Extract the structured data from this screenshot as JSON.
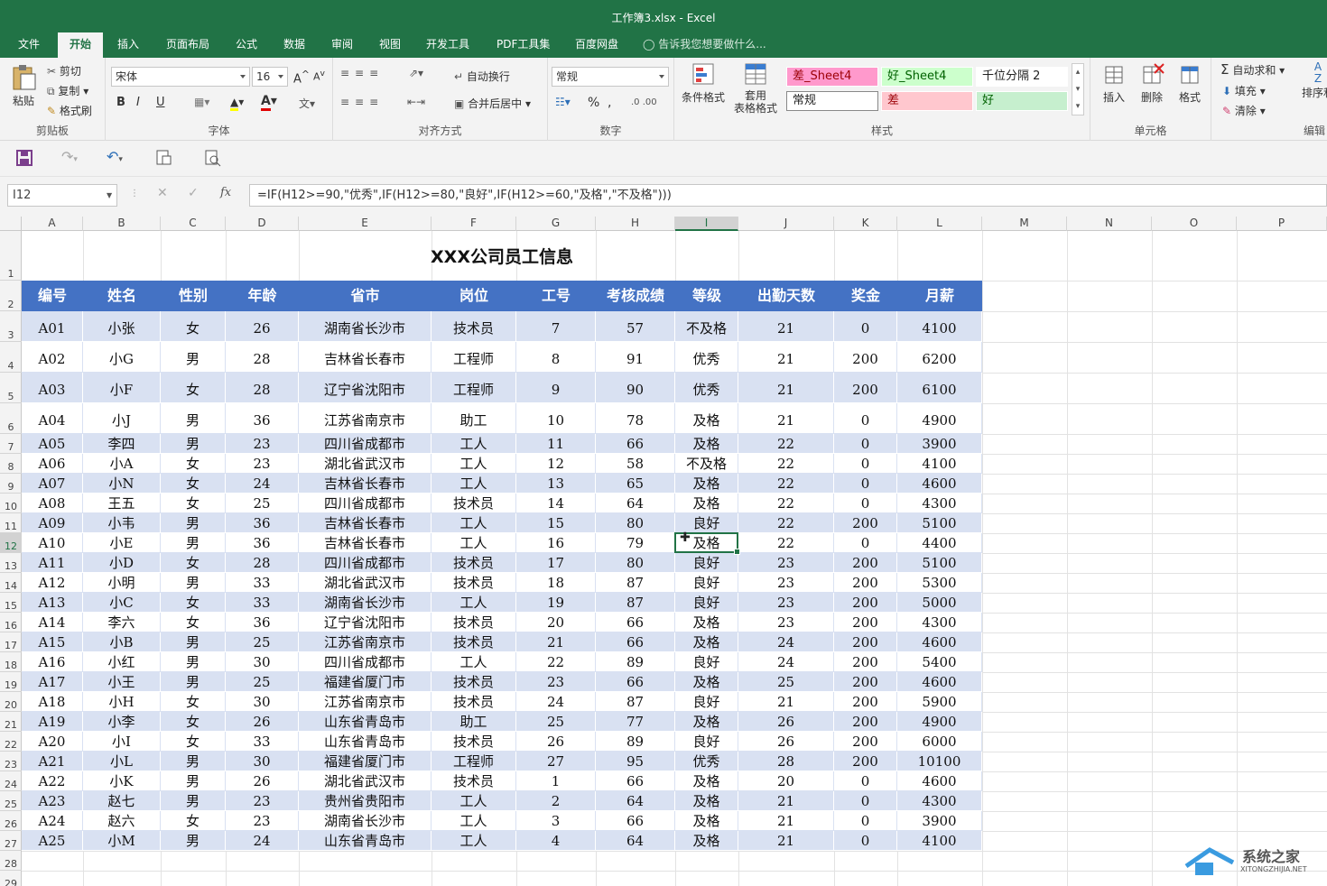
{
  "window": {
    "title": "工作簿3.xlsx - Excel"
  },
  "ribbon_tabs": [
    "文件",
    "开始",
    "插入",
    "页面布局",
    "公式",
    "数据",
    "审阅",
    "视图",
    "开发工具",
    "PDF工具集",
    "百度网盘"
  ],
  "tell_me": "告诉我您想要做什么...",
  "clipboard": {
    "paste": "粘贴",
    "cut": "剪切",
    "copy": "复制",
    "format_painter": "格式刷",
    "label": "剪贴板"
  },
  "font": {
    "name": "宋体",
    "size": "16",
    "bold": "B",
    "italic": "I",
    "underline": "U",
    "label": "字体"
  },
  "alignment": {
    "wrap": "自动换行",
    "merge": "合并后居中",
    "label": "对齐方式"
  },
  "number": {
    "format": "常规",
    "percent": "%",
    "comma": ",",
    "label": "数字"
  },
  "styles": {
    "conditional": "条件格式",
    "table_format_1": "套用",
    "table_format_2": "表格格式",
    "cells": [
      {
        "text": "差_Sheet4",
        "bg": "#ff99cc",
        "fg": "#9c0006"
      },
      {
        "text": "好_Sheet4",
        "bg": "#ccffcc",
        "fg": "#006100"
      },
      {
        "text": "千位分隔 2",
        "bg": "#ffffff",
        "fg": "#222222"
      },
      {
        "text": "常规",
        "bg": "#ffffff",
        "fg": "#222222"
      },
      {
        "text": "差",
        "bg": "#ffc7ce",
        "fg": "#9c0006"
      },
      {
        "text": "好",
        "bg": "#c6efce",
        "fg": "#006100"
      }
    ],
    "label": "样式"
  },
  "cells_group": {
    "insert": "插入",
    "delete": "删除",
    "format": "格式",
    "label": "单元格"
  },
  "editing": {
    "autosum": "自动求和",
    "fill": "填充",
    "clear": "清除",
    "sort": "排序和",
    "label": "编辑"
  },
  "formula_bar": {
    "name_box": "I12",
    "fx": "fx",
    "formula": "=IF(H12>=90,\"优秀\",IF(H12>=80,\"良好\",IF(H12>=60,\"及格\",\"不及格\")))"
  },
  "column_letters": [
    "A",
    "B",
    "C",
    "D",
    "E",
    "F",
    "G",
    "H",
    "I",
    "J",
    "K",
    "L",
    "M",
    "N",
    "O",
    "P"
  ],
  "row_numbers": [
    "1",
    "2",
    "3",
    "4",
    "5",
    "6",
    "7",
    "8",
    "9",
    "10",
    "11",
    "12",
    "13",
    "14",
    "15",
    "16",
    "17",
    "18",
    "19",
    "20",
    "21",
    "22",
    "23",
    "24",
    "25",
    "26",
    "27",
    "28",
    "29"
  ],
  "sheet": {
    "title": "XXX公司员工信息",
    "headers": [
      "编号",
      "姓名",
      "性别",
      "年龄",
      "省市",
      "岗位",
      "工号",
      "考核成绩",
      "等级",
      "出勤天数",
      "奖金",
      "月薪"
    ],
    "rows": [
      [
        "A01",
        "小张",
        "女",
        "26",
        "湖南省长沙市",
        "技术员",
        "7",
        "57",
        "不及格",
        "21",
        "0",
        "4100"
      ],
      [
        "A02",
        "小G",
        "男",
        "28",
        "吉林省长春市",
        "工程师",
        "8",
        "91",
        "优秀",
        "21",
        "200",
        "6200"
      ],
      [
        "A03",
        "小F",
        "女",
        "28",
        "辽宁省沈阳市",
        "工程师",
        "9",
        "90",
        "优秀",
        "21",
        "200",
        "6100"
      ],
      [
        "A04",
        "小J",
        "男",
        "36",
        "江苏省南京市",
        "助工",
        "10",
        "78",
        "及格",
        "21",
        "0",
        "4900"
      ],
      [
        "A05",
        "李四",
        "男",
        "23",
        "四川省成都市",
        "工人",
        "11",
        "66",
        "及格",
        "22",
        "0",
        "3900"
      ],
      [
        "A06",
        "小A",
        "女",
        "23",
        "湖北省武汉市",
        "工人",
        "12",
        "58",
        "不及格",
        "22",
        "0",
        "4100"
      ],
      [
        "A07",
        "小N",
        "女",
        "24",
        "吉林省长春市",
        "工人",
        "13",
        "65",
        "及格",
        "22",
        "0",
        "4600"
      ],
      [
        "A08",
        "王五",
        "女",
        "25",
        "四川省成都市",
        "技术员",
        "14",
        "64",
        "及格",
        "22",
        "0",
        "4300"
      ],
      [
        "A09",
        "小韦",
        "男",
        "36",
        "吉林省长春市",
        "工人",
        "15",
        "80",
        "良好",
        "22",
        "200",
        "5100"
      ],
      [
        "A10",
        "小E",
        "男",
        "36",
        "吉林省长春市",
        "工人",
        "16",
        "79",
        "及格",
        "22",
        "0",
        "4400"
      ],
      [
        "A11",
        "小D",
        "女",
        "28",
        "四川省成都市",
        "技术员",
        "17",
        "80",
        "良好",
        "23",
        "200",
        "5100"
      ],
      [
        "A12",
        "小明",
        "男",
        "33",
        "湖北省武汉市",
        "技术员",
        "18",
        "87",
        "良好",
        "23",
        "200",
        "5300"
      ],
      [
        "A13",
        "小C",
        "女",
        "33",
        "湖南省长沙市",
        "工人",
        "19",
        "87",
        "良好",
        "23",
        "200",
        "5000"
      ],
      [
        "A14",
        "李六",
        "女",
        "36",
        "辽宁省沈阳市",
        "技术员",
        "20",
        "66",
        "及格",
        "23",
        "200",
        "4300"
      ],
      [
        "A15",
        "小B",
        "男",
        "25",
        "江苏省南京市",
        "技术员",
        "21",
        "66",
        "及格",
        "24",
        "200",
        "4600"
      ],
      [
        "A16",
        "小红",
        "男",
        "30",
        "四川省成都市",
        "工人",
        "22",
        "89",
        "良好",
        "24",
        "200",
        "5400"
      ],
      [
        "A17",
        "小王",
        "男",
        "25",
        "福建省厦门市",
        "技术员",
        "23",
        "66",
        "及格",
        "25",
        "200",
        "4600"
      ],
      [
        "A18",
        "小H",
        "女",
        "30",
        "江苏省南京市",
        "技术员",
        "24",
        "87",
        "良好",
        "21",
        "200",
        "5900"
      ],
      [
        "A19",
        "小李",
        "女",
        "26",
        "山东省青岛市",
        "助工",
        "25",
        "77",
        "及格",
        "26",
        "200",
        "4900"
      ],
      [
        "A20",
        "小I",
        "女",
        "33",
        "山东省青岛市",
        "技术员",
        "26",
        "89",
        "良好",
        "26",
        "200",
        "6000"
      ],
      [
        "A21",
        "小L",
        "男",
        "30",
        "福建省厦门市",
        "工程师",
        "27",
        "95",
        "优秀",
        "28",
        "200",
        "10100"
      ],
      [
        "A22",
        "小K",
        "男",
        "26",
        "湖北省武汉市",
        "技术员",
        "1",
        "66",
        "及格",
        "20",
        "0",
        "4600"
      ],
      [
        "A23",
        "赵七",
        "男",
        "23",
        "贵州省贵阳市",
        "工人",
        "2",
        "64",
        "及格",
        "21",
        "0",
        "4300"
      ],
      [
        "A24",
        "赵六",
        "女",
        "23",
        "湖南省长沙市",
        "工人",
        "3",
        "66",
        "及格",
        "21",
        "0",
        "3900"
      ],
      [
        "A25",
        "小M",
        "男",
        "24",
        "山东省青岛市",
        "工人",
        "4",
        "64",
        "及格",
        "21",
        "0",
        "4100"
      ]
    ]
  },
  "watermark": {
    "brand": "系统之家",
    "url": "XITONGZHIJIA.NET"
  },
  "colors": {
    "excel_green": "#217346",
    "header_blue": "#4472c4",
    "row_band": "#d9e1f2"
  }
}
